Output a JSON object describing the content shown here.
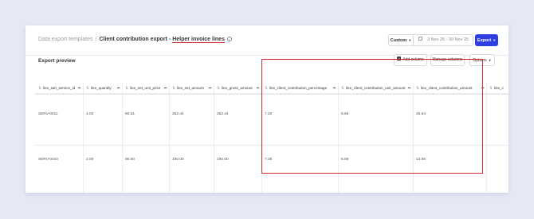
{
  "breadcrumb": {
    "parent": "Data export templates",
    "separator": "/",
    "title": "Client contribution export -",
    "subtitle": "Helper invoice lines"
  },
  "header": {
    "custom_label": "Custom",
    "date_range": "3 Nov 25 - 30 Nov 25",
    "export_label": "Export"
  },
  "preview": {
    "title": "Export preview",
    "add_column": "Add column",
    "manage_columns": "Manage columns",
    "options": "Options"
  },
  "table": {
    "columns": [
      "line_sah_service_id",
      "line_quantity",
      "line_net_unit_price",
      "line_net_amount",
      "line_gross_amount",
      "line_client_contribution_percentage",
      "line_client_contribution_unit_amount",
      "line_client_contribution_amount",
      "line_c"
    ],
    "rows": [
      [
        "SERV-0011",
        "4.00",
        "90.61",
        "362.44",
        "362.44",
        "7.20",
        "6.66",
        "26.64",
        ""
      ],
      [
        "SERV-0010",
        "2.00",
        "95.00",
        "190.00",
        "190.00",
        "7.35",
        "6.98",
        "13.96",
        ""
      ]
    ]
  },
  "colors": {
    "accent": "#2d3fe0",
    "highlight": "#d42a35"
  }
}
